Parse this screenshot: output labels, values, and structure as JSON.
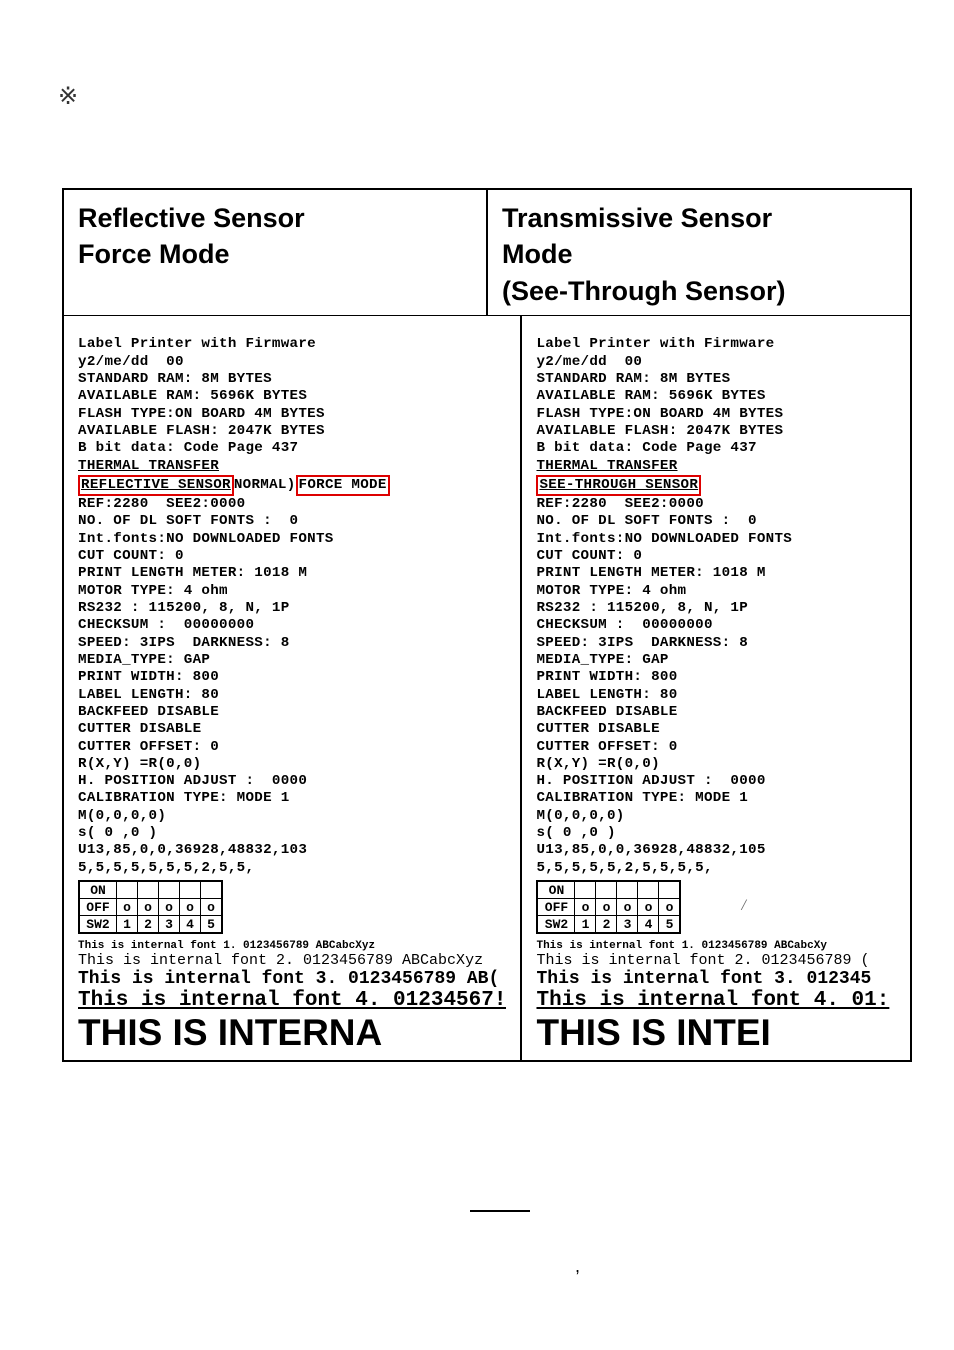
{
  "icon_glyph": "※",
  "columns": {
    "left_heading_line1": "Reflective Sensor",
    "left_heading_line2": "Force Mode",
    "right_heading_line1": "Transmissive Sensor",
    "right_heading_line2": "Mode",
    "right_heading_line3": "(See-Through Sensor)"
  },
  "reflective": {
    "l01": "Label Printer with Firmware",
    "l02": "y2/me/dd  00",
    "l03": "STANDARD RAM: 8M BYTES",
    "l04": "AVAILABLE RAM: 5696K BYTES",
    "l05": "FLASH TYPE:ON BOARD 4M BYTES",
    "l06": "AVAILABLE FLASH: 2047K BYTES",
    "l07": "B bit data: Code Page 437",
    "l08": "THERMAL TRANSFER",
    "sensor_box": "REFLECTIVE SENSOR",
    "sensor_mid": "NORMAL)",
    "sensor_box2": "FORCE MODE",
    "l10": "REF:2280  SEE2:0000",
    "l11": "NO. OF DL SOFT FONTS :  0",
    "l12": "Int.fonts:NO DOWNLOADED FONTS",
    "l13": "CUT COUNT: 0",
    "l14": "PRINT LENGTH METER: 1018 M",
    "l15": "MOTOR TYPE: 4 ohm",
    "l16": "RS232 : 115200, 8, N, 1P",
    "l17": "CHECKSUM :  00000000",
    "l18": "SPEED: 3IPS  DARKNESS: 8",
    "l19": "MEDIA_TYPE: GAP",
    "l20": "PRINT WIDTH: 800",
    "l21": "LABEL LENGTH: 80",
    "l22": "BACKFEED DISABLE",
    "l23": "CUTTER DISABLE",
    "l24": "CUTTER OFFSET: 0",
    "l25": "R(X,Y) =R(0,0)",
    "l26": "H. POSITION ADJUST :  0000",
    "l27": "CALIBRATION TYPE: MODE 1",
    "l28": "M(0,0,0,0)",
    "l29": "s( 0 ,0 )",
    "l30": "U13,85,0,0,36928,48832,103",
    "l31": "5,5,5,5,5,5,5,2,5,5,",
    "dip_on": "ON",
    "dip_off": "OFF",
    "dip_sw2": "SW2",
    "font_sample_1": "This is internal font 1. 0123456789 ABCabcXyz",
    "font_sample_2": "This is internal font 2. 0123456789 ABCabcXyz",
    "font_sample_3": "This is internal font 3. 0123456789 AB(",
    "font_sample_4": "This is internal font 4. 01234567!",
    "font_sample_5": "THIS IS INTERNA"
  },
  "transmissive": {
    "l01": "Label Printer with Firmware",
    "l02": "y2/me/dd  00",
    "l03": "STANDARD RAM: 8M BYTES",
    "l04": "AVAILABLE RAM: 5696K BYTES",
    "l05": "FLASH TYPE:ON BOARD 4M BYTES",
    "l06": "AVAILABLE FLASH: 2047K BYTES",
    "l07": "B bit data: Code Page 437",
    "l08": "THERMAL TRANSFER",
    "sensor_box": "SEE-THROUGH SENSOR",
    "l10": "REF:2280  SEE2:0000",
    "l11": "NO. OF DL SOFT FONTS :  0",
    "l12": "Int.fonts:NO DOWNLOADED FONTS",
    "l13": "CUT COUNT: 0",
    "l14": "PRINT LENGTH METER: 1018 M",
    "l15": "MOTOR TYPE: 4 ohm",
    "l16": "RS232 : 115200, 8, N, 1P",
    "l17": "CHECKSUM :  00000000",
    "l18": "SPEED: 3IPS  DARKNESS: 8",
    "l19": "MEDIA_TYPE: GAP",
    "l20": "PRINT WIDTH: 800",
    "l21": "LABEL LENGTH: 80",
    "l22": "BACKFEED DISABLE",
    "l23": "CUTTER DISABLE",
    "l24": "CUTTER OFFSET: 0",
    "l25": "R(X,Y) =R(0,0)",
    "l26": "H. POSITION ADJUST :  0000",
    "l27": "CALIBRATION TYPE: MODE 1",
    "l28": "M(0,0,0,0)",
    "l29": "s( 0 ,0 )",
    "l30": "U13,85,0,0,36928,48832,105",
    "l31": "5,5,5,5,5,2,5,5,5,5,",
    "dip_on": "ON",
    "dip_off": "OFF",
    "dip_sw2": "SW2",
    "sidemark": "/",
    "font_sample_1": "This is internal font 1. 0123456789 ABCabcXy",
    "font_sample_2": "This is internal font 2. 0123456789 (",
    "font_sample_3": "This is internal font 3. 012345",
    "font_sample_4": "This is internal font 4. 01:",
    "font_sample_5": "THIS IS INTEI"
  },
  "dip_numbers": [
    "1",
    "2",
    "3",
    "4",
    "5"
  ]
}
